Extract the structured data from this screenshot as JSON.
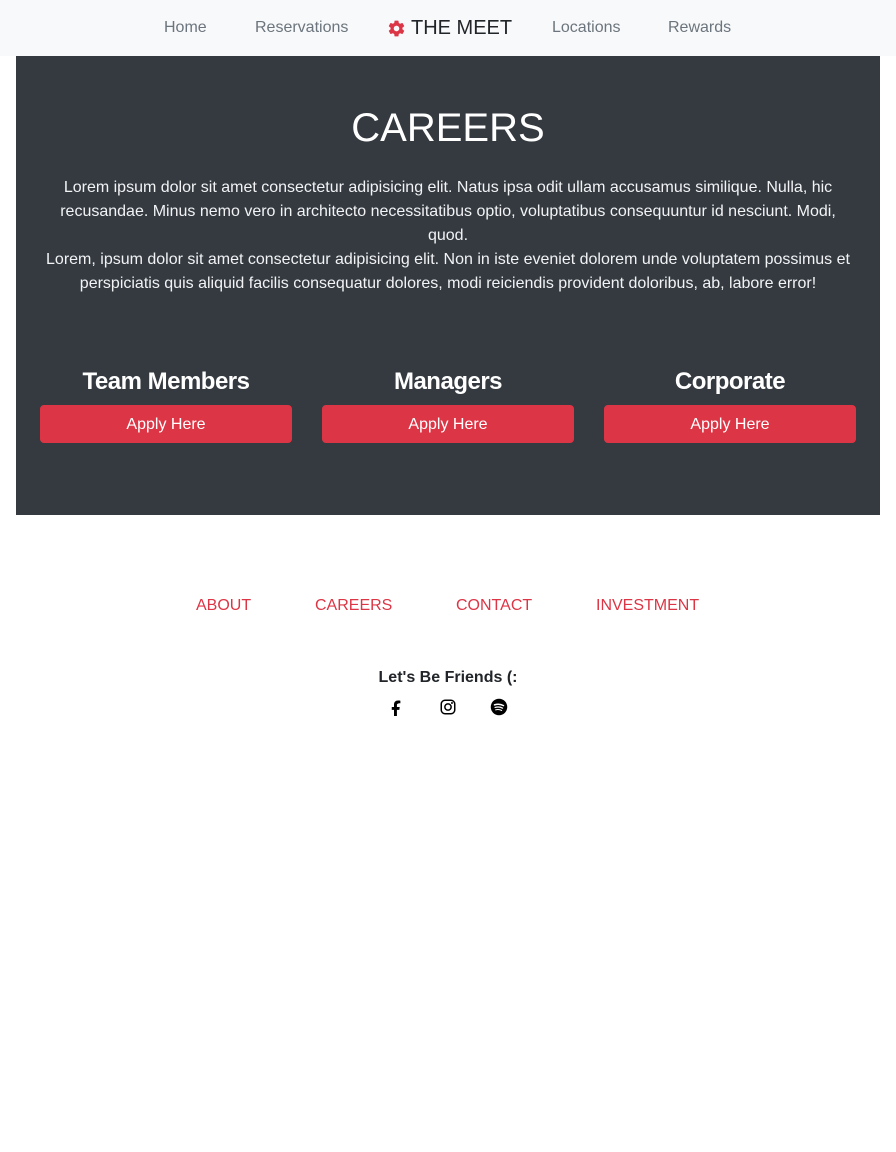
{
  "nav": {
    "items": [
      {
        "label": "Home"
      },
      {
        "label": "Reservations"
      },
      {
        "label": "Locations"
      },
      {
        "label": "Rewards"
      }
    ],
    "brand": {
      "label": "THE MEET",
      "icon": "gear-icon",
      "icon_color": "#dc3545"
    }
  },
  "careers": {
    "title": "CAREERS",
    "paragraphs": [
      "Lorem ipsum dolor sit amet consectetur adipisicing elit. Natus ipsa odit ullam accusamus similique. Nulla, hic recusandae. Minus nemo vero in architecto necessitatibus optio, voluptatibus consequuntur id nesciunt. Modi, quod.",
      "Lorem, ipsum dolor sit amet consectetur adipisicing elit. Non in iste eveniet dolorem unde voluptatem possimus et perspiciatis quis aliquid facilis consequatur dolores, modi reiciendis provident doloribus, ab, labore error!"
    ],
    "roles": [
      {
        "title": "Team Members",
        "button": "Apply Here"
      },
      {
        "title": "Managers",
        "button": "Apply Here"
      },
      {
        "title": "Corporate",
        "button": "Apply Here"
      }
    ]
  },
  "footer": {
    "links": [
      {
        "label": "ABOUT"
      },
      {
        "label": "CAREERS"
      },
      {
        "label": "CONTACT"
      },
      {
        "label": "INVESTMENT"
      }
    ],
    "friends_label": "Let's Be Friends (:",
    "social": [
      {
        "icon": "facebook-icon"
      },
      {
        "icon": "instagram-icon"
      },
      {
        "icon": "spotify-icon"
      }
    ]
  },
  "colors": {
    "accent": "#dc3545",
    "section_bg": "#343a40",
    "navbar_bg": "#f8f9fa",
    "nav_text": "#6c757d"
  }
}
